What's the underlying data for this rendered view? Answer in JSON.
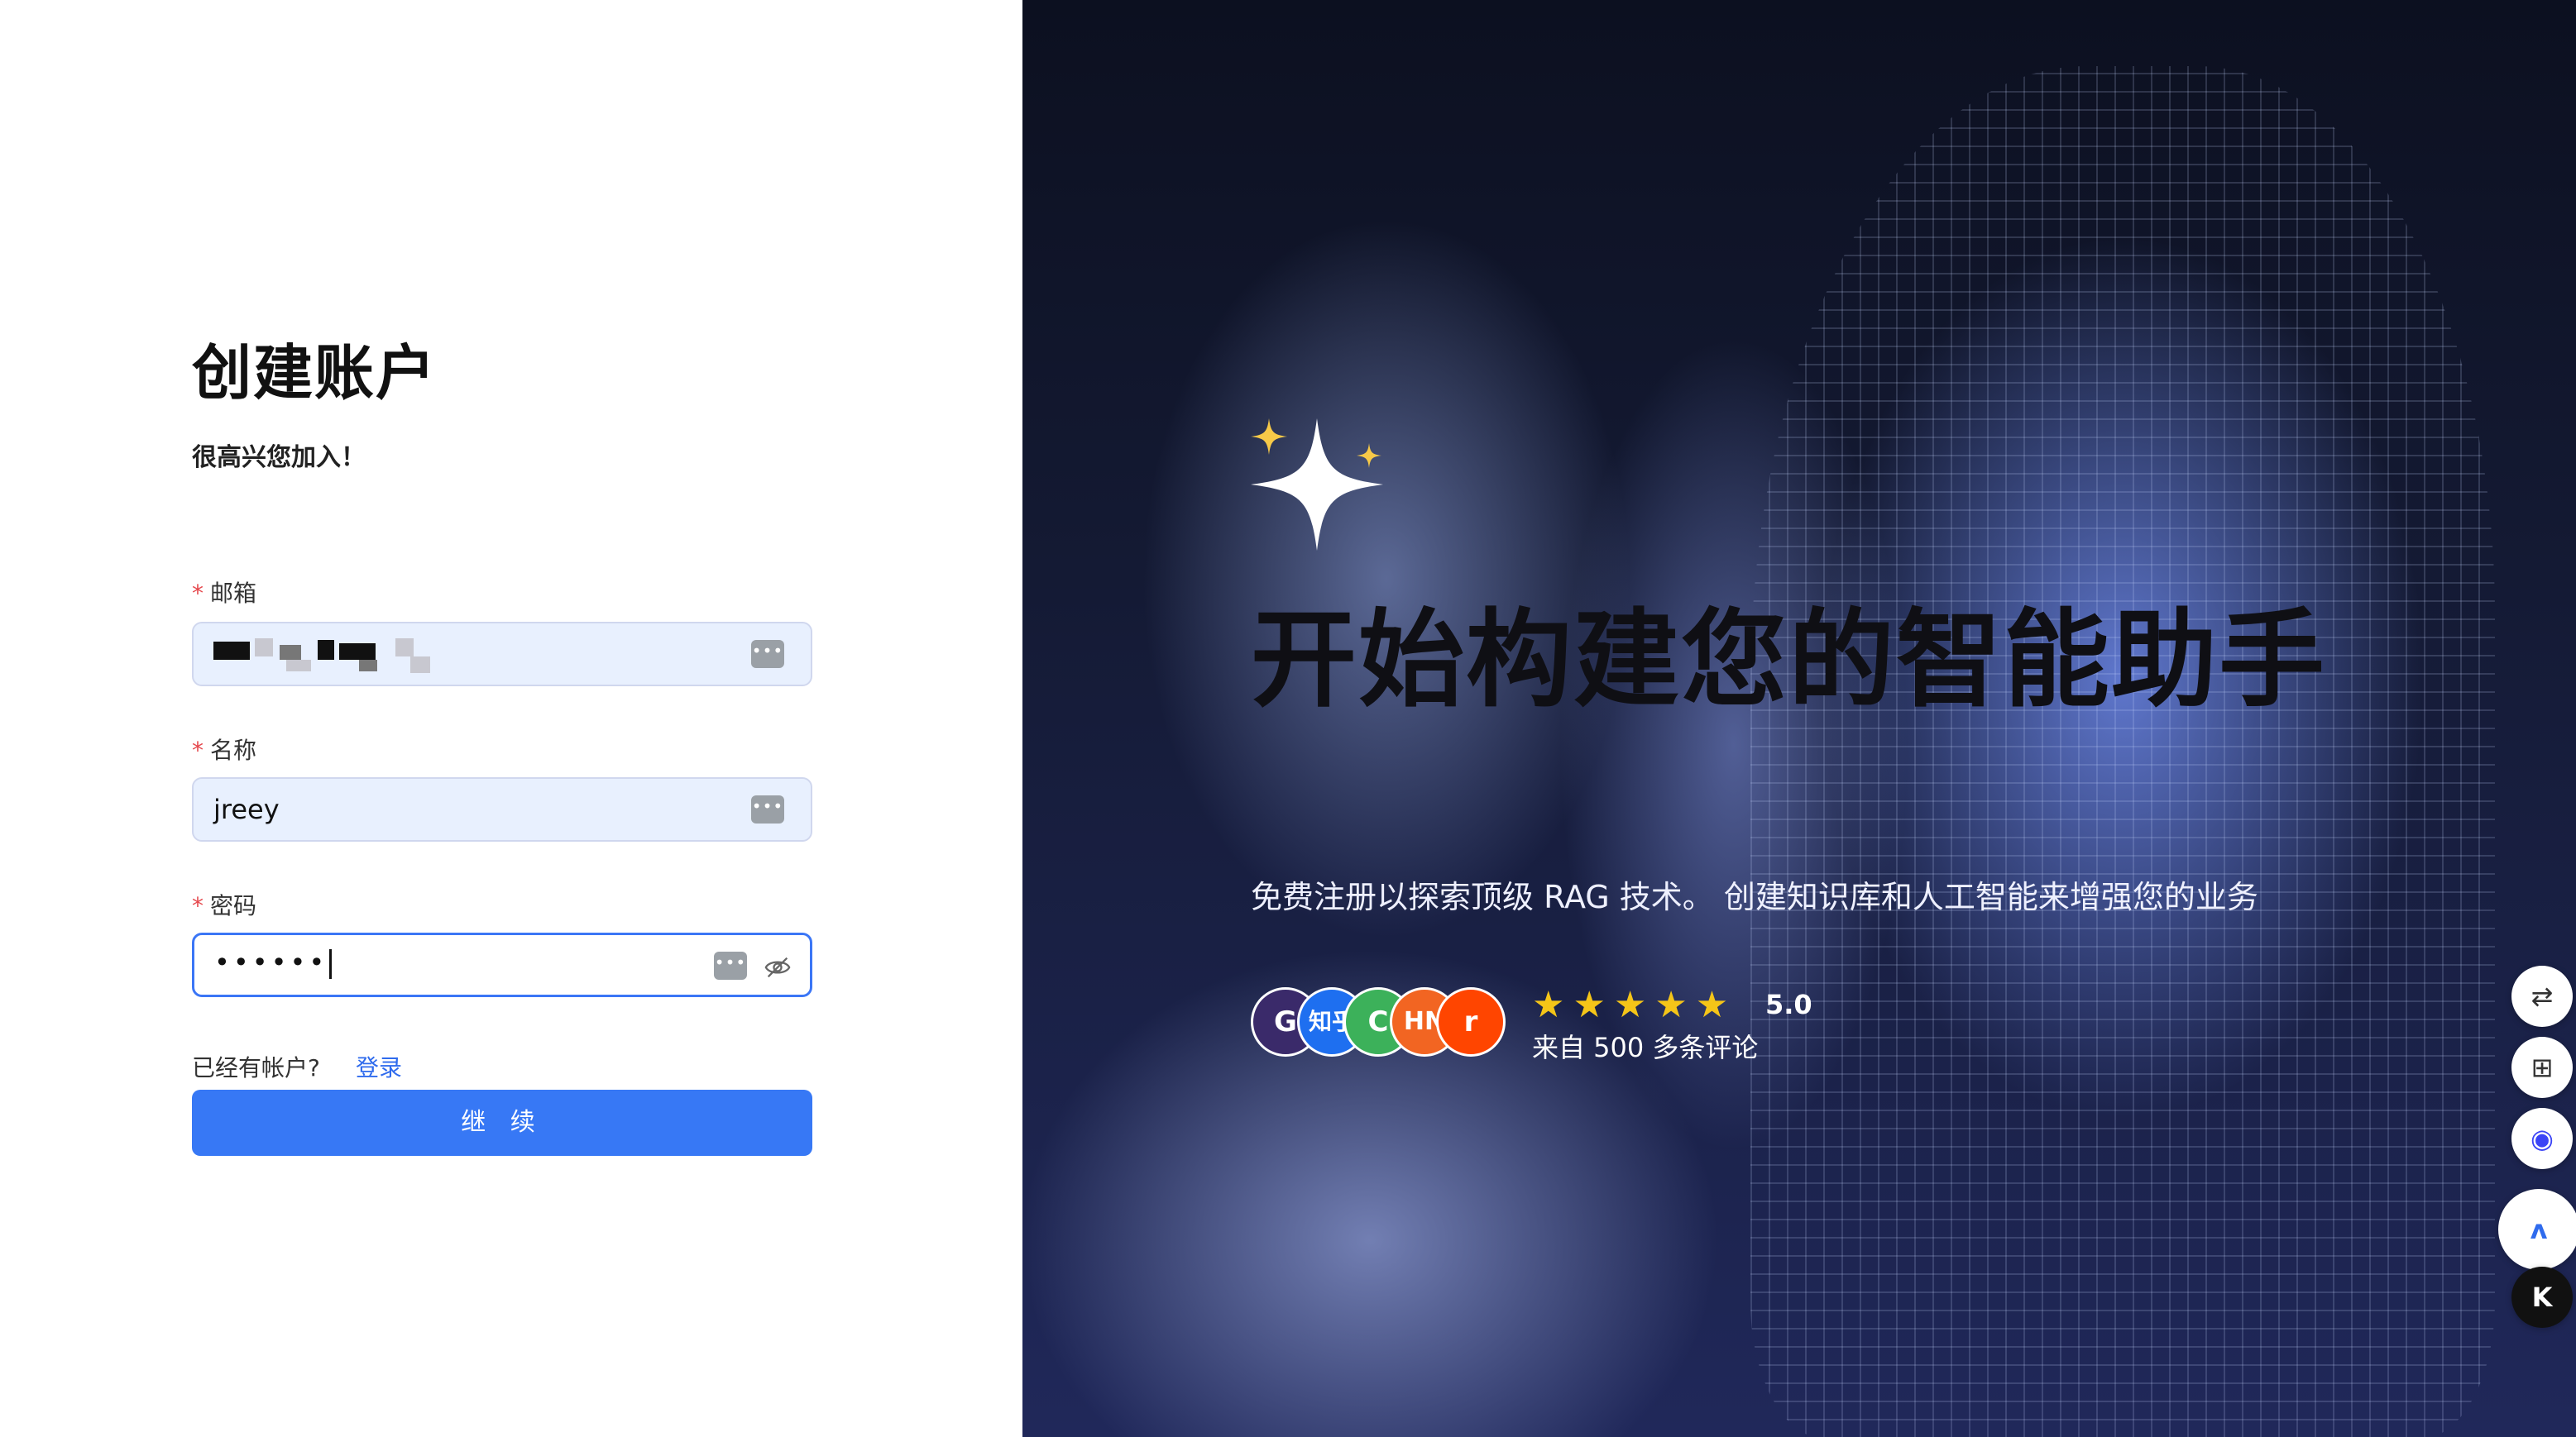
{
  "form": {
    "title": "创建账户",
    "subtitle": "很高兴您加入！",
    "required_mark": "*",
    "email": {
      "label": "邮箱",
      "value": ""
    },
    "name": {
      "label": "名称",
      "value": "jreey"
    },
    "password": {
      "label": "密码",
      "value": "••••••"
    },
    "has_account_text": "已经有帐户?",
    "login_link": "登录",
    "continue_button": "继 续"
  },
  "hero": {
    "title": "开始构建您的智能助手",
    "subtitle": "免费注册以探索顶级 RAG 技术。 创建知识库和人工智能来增强您的业务",
    "avatars": [
      "G",
      "知乎",
      "C",
      "HN",
      "r"
    ],
    "rating": "5.0",
    "reviews": "来自 500 多条评论"
  },
  "colors": {
    "primary": "#3778f5",
    "required": "#e5484d",
    "link": "#2f6bed",
    "star": "#f5c518"
  },
  "side_tools": [
    "translate-icon",
    "apps-icon",
    "bot-icon",
    "ai-logo-icon",
    "k-logo-icon"
  ]
}
